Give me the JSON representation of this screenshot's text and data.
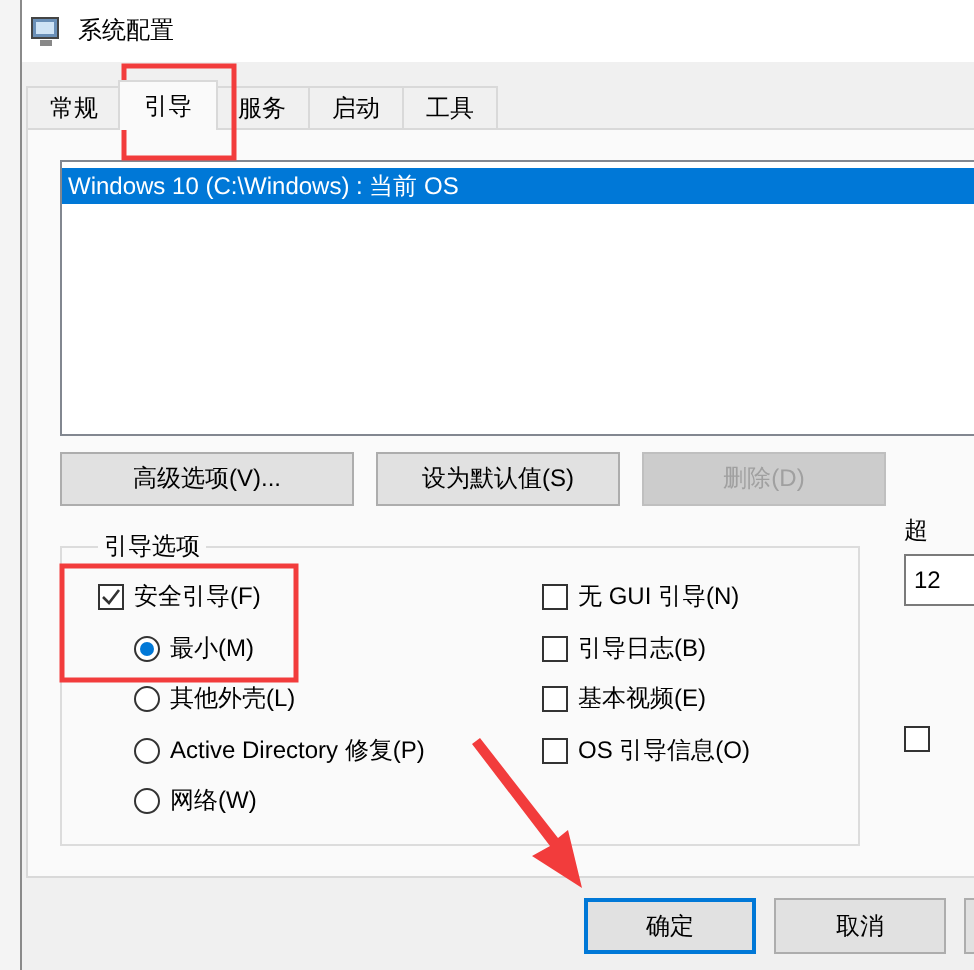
{
  "window": {
    "title": "系统配置"
  },
  "tabs": [
    {
      "label": "常规",
      "selected": false
    },
    {
      "label": "引导",
      "selected": true
    },
    {
      "label": "服务",
      "selected": false
    },
    {
      "label": "启动",
      "selected": false
    },
    {
      "label": "工具",
      "selected": false
    }
  ],
  "boot_list": [
    {
      "label": "Windows 10 (C:\\Windows) : 当前 OS",
      "selected": true
    }
  ],
  "buttons": [
    {
      "label": "高级选项(V)...",
      "disabled": false
    },
    {
      "label": "设为默认值(S)",
      "disabled": false
    },
    {
      "label": "删除(D)",
      "disabled": true
    }
  ],
  "boot_options": {
    "title": "引导选项",
    "left": [
      {
        "kind": "checkbox",
        "label": "安全引导(F)",
        "checked": true
      },
      {
        "kind": "radio",
        "label": "最小(M)",
        "checked": true
      },
      {
        "kind": "radio",
        "label": "其他外壳(L)",
        "checked": false
      },
      {
        "kind": "radio",
        "label": "Active Directory 修复(P)",
        "checked": false
      },
      {
        "kind": "radio",
        "label": "网络(W)",
        "checked": false
      }
    ],
    "right": [
      {
        "kind": "checkbox",
        "label": "无 GUI 引导(N)",
        "checked": false
      },
      {
        "kind": "checkbox",
        "label": "引导日志(B)",
        "checked": false
      },
      {
        "kind": "checkbox",
        "label": "基本视频(E)",
        "checked": false
      },
      {
        "kind": "checkbox",
        "label": "OS 引导信息(O)",
        "checked": false
      }
    ]
  },
  "timeout": {
    "label": "超",
    "value": "12"
  },
  "extra_option": {
    "checked": false
  },
  "footer_buttons": [
    {
      "label": "确定",
      "focused": true
    },
    {
      "label": "取消",
      "focused": false
    }
  ]
}
